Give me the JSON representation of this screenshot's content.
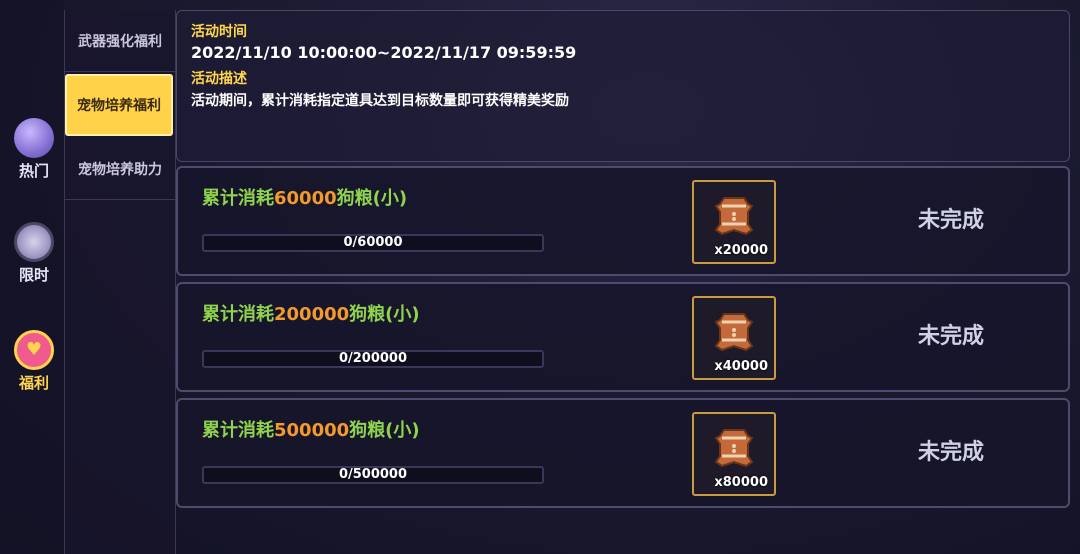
{
  "sidebar": {
    "categories": [
      {
        "label": "热门",
        "icon": "slime-icon"
      },
      {
        "label": "限时",
        "icon": "clock-icon"
      },
      {
        "label": "福利",
        "icon": "gift-heart-icon"
      }
    ],
    "active_category": "福利"
  },
  "subtabs": [
    {
      "label": "武器强化福利"
    },
    {
      "label": "宠物培养福利"
    },
    {
      "label": "宠物培养助力"
    }
  ],
  "active_subtab": "宠物培养福利",
  "event": {
    "time_heading": "活动时间",
    "time_value": "2022/11/10 10:00:00~2022/11/17 09:59:59",
    "desc_heading": "活动描述",
    "desc_value": "活动期间，累计消耗指定道具达到目标数量即可获得精美奖励"
  },
  "tasks": [
    {
      "prefix": "累计消耗",
      "amount": "60000",
      "suffix": "狗粮(小)",
      "progress_text": "0/60000",
      "progress_fraction": 0,
      "reward_icon": "gingerbread-item-icon",
      "reward_qty": "x20000",
      "status": "未完成"
    },
    {
      "prefix": "累计消耗",
      "amount": "200000",
      "suffix": "狗粮(小)",
      "progress_text": "0/200000",
      "progress_fraction": 0,
      "reward_icon": "gingerbread-item-icon",
      "reward_qty": "x40000",
      "status": "未完成"
    },
    {
      "prefix": "累计消耗",
      "amount": "500000",
      "suffix": "狗粮(小)",
      "progress_text": "0/500000",
      "progress_fraction": 0,
      "reward_icon": "gingerbread-item-icon",
      "reward_qty": "x80000",
      "status": "未完成"
    }
  ],
  "colors": {
    "accent_yellow": "#ffd24a",
    "green": "#8fd44c",
    "orange": "#f39a2a",
    "frame_gold": "#c89b3c"
  }
}
